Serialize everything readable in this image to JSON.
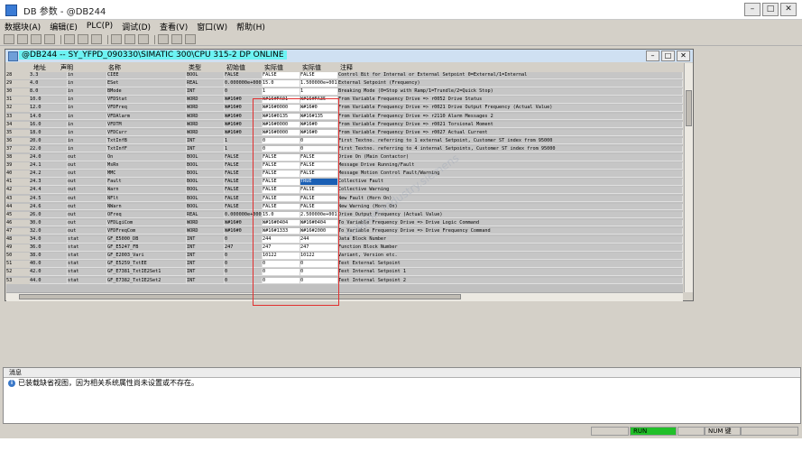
{
  "window": {
    "title": "DB 参数 - @DB244"
  },
  "menu": [
    "数据块(A)",
    "编辑(E)",
    "PLC(P)",
    "调试(D)",
    "查看(V)",
    "窗口(W)",
    "帮助(H)"
  ],
  "dbwindow": {
    "title": "@DB244 -- SY_YFPD_090330\\SIMATIC 300\\CPU 315-2 DP  ONLINE"
  },
  "columns": [
    "地址",
    "声明",
    "名称",
    "类型",
    "初始值",
    "实际值",
    "实际值",
    "注释"
  ],
  "rows": [
    {
      "n": "28",
      "addr": "3.3",
      "decl": "in",
      "name": "CIEE",
      "type": "BOOL",
      "init": "FALSE",
      "act": "FALSE",
      "cur": "FALSE",
      "comm": "Control Bit for Internal or External Setpoint 0=External/1=Internal"
    },
    {
      "n": "29",
      "addr": "4.0",
      "decl": "in",
      "name": "ESet",
      "type": "REAL",
      "init": "0.000000e+000",
      "act": "15.0",
      "cur": "1.500000e+001",
      "comm": "External Setpoint (Frequency)"
    },
    {
      "n": "30",
      "addr": "8.0",
      "decl": "in",
      "name": "BMode",
      "type": "INT",
      "init": "0",
      "act": "1",
      "cur": "1",
      "comm": "Breaking Mode (0=Stop with Ramp/1=Trundle/2=Quick Stop)"
    },
    {
      "n": "31",
      "addr": "10.0",
      "decl": "in",
      "name": "VFDStat",
      "type": "WORD",
      "init": "W#16#0",
      "act": "W#16#FA01",
      "cur": "W#16#FA35",
      "comm": "From Variable Frequency Drive => r0052 Drive Status"
    },
    {
      "n": "32",
      "addr": "12.0",
      "decl": "in",
      "name": "VFDFreq",
      "type": "WORD",
      "init": "W#16#0",
      "act": "W#16#0000",
      "cur": "W#16#0",
      "comm": "From Variable Frequency Drive => r0021 Drive Output Frequency (Actual Value)"
    },
    {
      "n": "33",
      "addr": "14.0",
      "decl": "in",
      "name": "VFDAlarm",
      "type": "WORD",
      "init": "W#16#0",
      "act": "W#16#0135",
      "cur": "W#16#135",
      "comm": "From Variable Frequency Drive => r2110 Alarm Messages 2"
    },
    {
      "n": "34",
      "addr": "16.0",
      "decl": "in",
      "name": "VFDTM",
      "type": "WORD",
      "init": "W#16#0",
      "act": "W#16#0000",
      "cur": "W#16#0",
      "comm": "From Variable Frequency Drive => r0021 Torsional Moment"
    },
    {
      "n": "35",
      "addr": "18.0",
      "decl": "in",
      "name": "VFDCurr",
      "type": "WORD",
      "init": "W#16#0",
      "act": "W#16#0000",
      "cur": "W#16#0",
      "comm": "From Variable Frequency Drive => r0027 Actual Current"
    },
    {
      "n": "36",
      "addr": "20.0",
      "decl": "in",
      "name": "TxtInfB",
      "type": "INT",
      "init": "1",
      "act": "0",
      "cur": "0",
      "comm": "First Textno. referring to 1 external Setpoint, Customer ST index from 95000"
    },
    {
      "n": "37",
      "addr": "22.0",
      "decl": "in",
      "name": "TxtInfF",
      "type": "INT",
      "init": "1",
      "act": "0",
      "cur": "0",
      "comm": "First Textno. referring to 4 internal Setpoints, Customer ST index from 95000"
    },
    {
      "n": "38",
      "addr": "24.0",
      "decl": "out",
      "name": "On",
      "type": "BOOL",
      "init": "FALSE",
      "act": "FALSE",
      "cur": "FALSE",
      "comm": "Drive On (Main Contactor)"
    },
    {
      "n": "39",
      "addr": "24.1",
      "decl": "out",
      "name": "MsRn",
      "type": "BOOL",
      "init": "FALSE",
      "act": "FALSE",
      "cur": "FALSE",
      "comm": "Message Drive Running/Fault"
    },
    {
      "n": "40",
      "addr": "24.2",
      "decl": "out",
      "name": "MMC",
      "type": "BOOL",
      "init": "FALSE",
      "act": "FALSE",
      "cur": "FALSE",
      "comm": "Message Motion Control Fault/Warning"
    },
    {
      "n": "41",
      "addr": "24.3",
      "decl": "out",
      "name": "Fault",
      "type": "BOOL",
      "init": "FALSE",
      "act": "FALSE",
      "cur": "TRUE",
      "comm": "Collective Fault"
    },
    {
      "n": "42",
      "addr": "24.4",
      "decl": "out",
      "name": "Warn",
      "type": "BOOL",
      "init": "FALSE",
      "act": "FALSE",
      "cur": "FALSE",
      "comm": "Collective Warning"
    },
    {
      "n": "43",
      "addr": "24.5",
      "decl": "out",
      "name": "NFlt",
      "type": "BOOL",
      "init": "FALSE",
      "act": "FALSE",
      "cur": "FALSE",
      "comm": "New Fault (Horn On)"
    },
    {
      "n": "44",
      "addr": "24.6",
      "decl": "out",
      "name": "NWarn",
      "type": "BOOL",
      "init": "FALSE",
      "act": "FALSE",
      "cur": "FALSE",
      "comm": "New Warning (Horn On)"
    },
    {
      "n": "45",
      "addr": "26.0",
      "decl": "out",
      "name": "OFreq",
      "type": "REAL",
      "init": "0.000000e+000",
      "act": "15.0",
      "cur": "2.500000e+001",
      "comm": "Drive Output Frequency (Actual Value)"
    },
    {
      "n": "46",
      "addr": "30.0",
      "decl": "out",
      "name": "VFDLgiCom",
      "type": "WORD",
      "init": "W#16#0",
      "act": "W#16#0404",
      "cur": "W#16#0404",
      "comm": "To Variable Frequency Drive => Drive Logic Command"
    },
    {
      "n": "47",
      "addr": "32.0",
      "decl": "out",
      "name": "VFDFreqCom",
      "type": "WORD",
      "init": "W#16#0",
      "act": "W#16#1333",
      "cur": "W#16#2000",
      "comm": "To Variable Frequency Drive => Drive Frequency Command"
    },
    {
      "n": "48",
      "addr": "34.0",
      "decl": "stat",
      "name": "GF_E5000_DB",
      "type": "INT",
      "init": "0",
      "act": "244",
      "cur": "244",
      "comm": "Data Block Number"
    },
    {
      "n": "49",
      "addr": "36.0",
      "decl": "stat",
      "name": "GF_E5247_FB",
      "type": "INT",
      "init": "247",
      "act": "247",
      "cur": "247",
      "comm": "Function Block Number"
    },
    {
      "n": "50",
      "addr": "38.0",
      "decl": "stat",
      "name": "GF_E2003_Vari",
      "type": "INT",
      "init": "0",
      "act": "10122",
      "cur": "10122",
      "comm": "Variant, Version etc."
    },
    {
      "n": "51",
      "addr": "40.0",
      "decl": "stat",
      "name": "GF_E5259_TxtEE",
      "type": "INT",
      "init": "0",
      "act": "0",
      "cur": "0",
      "comm": "Text External Setpoint"
    },
    {
      "n": "52",
      "addr": "42.0",
      "decl": "stat",
      "name": "GF_E7381_TxtIE2Set1",
      "type": "INT",
      "init": "0",
      "act": "0",
      "cur": "0",
      "comm": "Text Internal Setpoint 1"
    },
    {
      "n": "53",
      "addr": "44.0",
      "decl": "stat",
      "name": "GF_E7382_TxtIE2Set2",
      "type": "INT",
      "init": "0",
      "act": "0",
      "cur": "0",
      "comm": "Text Internal Setpoint 2"
    }
  ],
  "messages": {
    "header": "消息",
    "line": "已装载缺省视图，因为相关系统属性尚未设置或不存在。"
  },
  "status": {
    "run": "RUN",
    "num": "NUM 键"
  },
  "colors": {
    "selection": "#1a5fb4",
    "highlight_box": "#e13030",
    "run_green": "#22c02a"
  }
}
